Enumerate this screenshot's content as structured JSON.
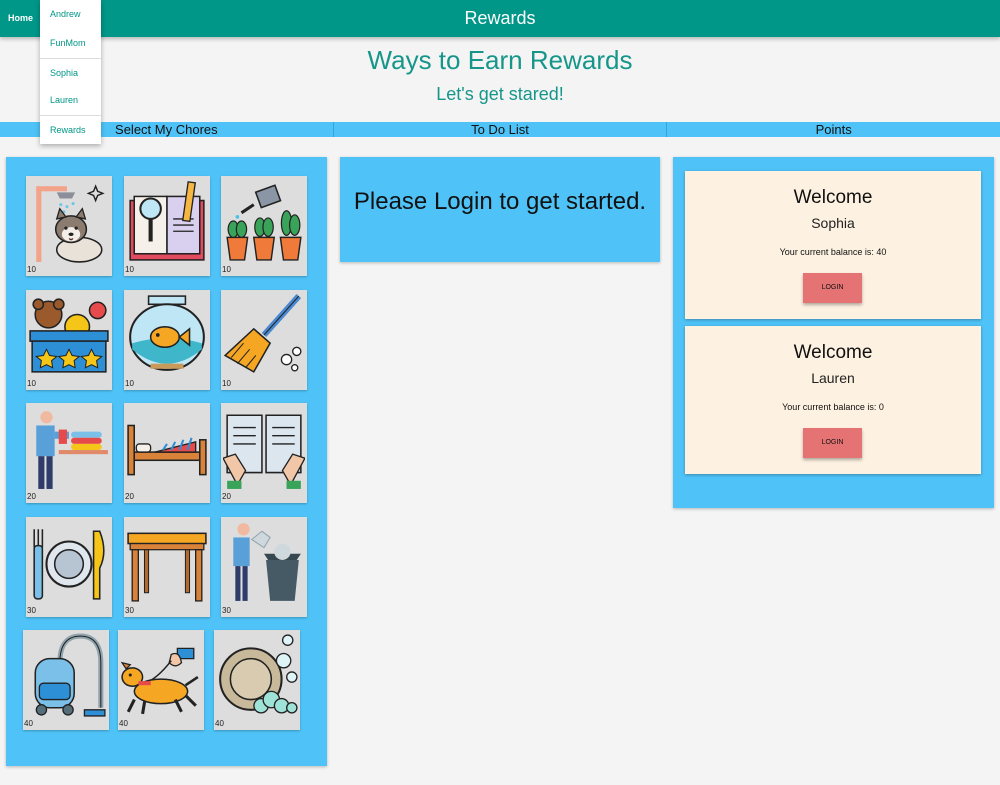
{
  "appbar": {
    "home_label": "Home",
    "title": "Rewards"
  },
  "menu": {
    "items": [
      {
        "label": "Andrew"
      },
      {
        "label": "FunMom"
      },
      {
        "label": "Sophia"
      },
      {
        "label": "Lauren"
      },
      {
        "label": "Rewards"
      }
    ]
  },
  "page": {
    "heading": "Ways to Earn Rewards",
    "subheading": "Let's get stared!"
  },
  "columns": {
    "chores": "Select My Chores",
    "todo": "To Do List",
    "points": "Points"
  },
  "chores": [
    {
      "icon": "bathe-dog-icon",
      "points": "10"
    },
    {
      "icon": "homework-icon",
      "points": "10"
    },
    {
      "icon": "water-plants-icon",
      "points": "10"
    },
    {
      "icon": "toy-box-icon",
      "points": "10"
    },
    {
      "icon": "fish-bowl-icon",
      "points": "10"
    },
    {
      "icon": "sweep-icon",
      "points": "10"
    },
    {
      "icon": "fold-laundry-icon",
      "points": "20"
    },
    {
      "icon": "make-bed-icon",
      "points": "20"
    },
    {
      "icon": "read-book-icon",
      "points": "20"
    },
    {
      "icon": "set-table-icon",
      "points": "30"
    },
    {
      "icon": "clear-table-icon",
      "points": "30"
    },
    {
      "icon": "take-out-trash-icon",
      "points": "30"
    },
    {
      "icon": "vacuum-icon",
      "points": "40"
    },
    {
      "icon": "walk-dog-icon",
      "points": "40"
    },
    {
      "icon": "wash-dishes-icon",
      "points": "40"
    }
  ],
  "todo": {
    "message": "Please Login to get started."
  },
  "accounts": [
    {
      "welcome": "Welcome",
      "name": "Sophia",
      "balance_text": "Your current balance is: 40",
      "login_label": "LOGIN"
    },
    {
      "welcome": "Welcome",
      "name": "Lauren",
      "balance_text": "Your current balance is: 0",
      "login_label": "LOGIN"
    }
  ],
  "colors": {
    "appbar": "#009688",
    "panel": "#4fc3f7",
    "card": "#fdf1e1",
    "login_button": "#e57373",
    "accent_text": "#16968a"
  }
}
